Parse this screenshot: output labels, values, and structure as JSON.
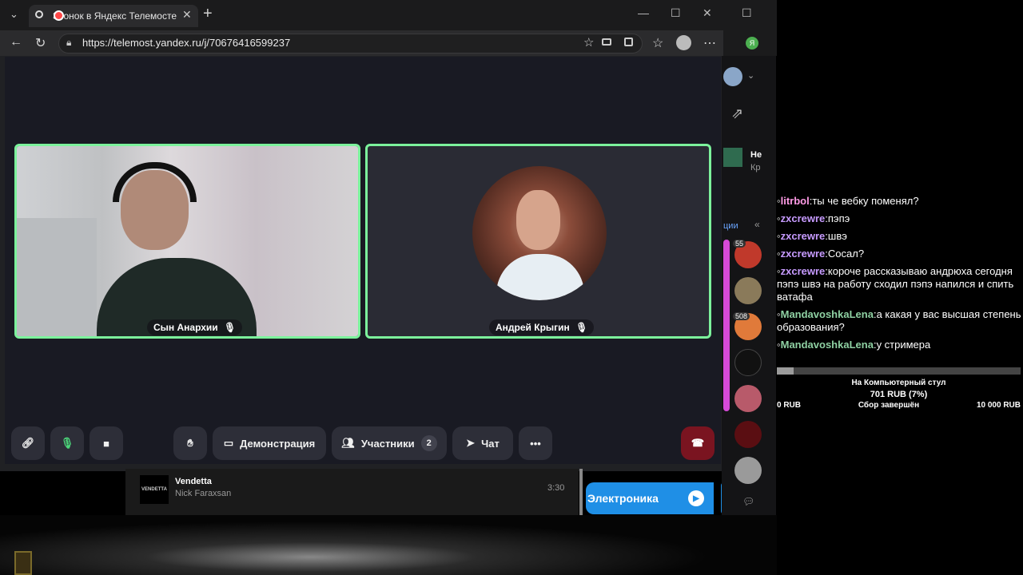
{
  "browser": {
    "tab_title": "Звонок в Яндекс Телемосте",
    "url": "https://telemost.yandex.ru/j/70676416599237",
    "ext_letter": "Я"
  },
  "call": {
    "participants": [
      {
        "name": "Сын Анархии"
      },
      {
        "name": "Андрей Крыгин"
      }
    ],
    "controls": {
      "demo_label": "Демонстрация",
      "participants_label": "Участники",
      "participants_count": "2",
      "chat_label": "Чат",
      "more_label": "•••"
    }
  },
  "music": {
    "track_title": "Vendetta",
    "track_artist": "Nick Faraxsan",
    "duration": "3:30",
    "cover_text": "VENDETTA",
    "promo_label": "Электроника"
  },
  "side": {
    "item_title": "Не",
    "item_sub": "Кр",
    "section_label": "ции",
    "badge_55": "55",
    "badge_508": "508"
  },
  "chat": [
    {
      "nick": "litrbol",
      "text": "ты че вебку поменял?",
      "color": "#ff9be6"
    },
    {
      "nick": "zxcrewre",
      "text": "пэпэ",
      "color": "#c79bff"
    },
    {
      "nick": "zxcrewre",
      "text": "швэ",
      "color": "#c79bff"
    },
    {
      "nick": "zxcrewre",
      "text": "Сосал?",
      "color": "#c79bff"
    },
    {
      "nick": "zxcrewre",
      "text": "короче рассказываю андрюха сегодня пэпэ швэ на работу сходил пэпэ напился и спить ватафа",
      "color": "#c79bff"
    },
    {
      "nick": "MandavoshkaLena",
      "text": "а какая у вас высшая степень образования?",
      "color": "#8fd1a3"
    },
    {
      "nick": "MandavoshkaLena",
      "text": "у стримера",
      "color": "#8fd1a3"
    }
  ],
  "donation": {
    "title": "На Компьютерный стул",
    "raised": "701 RUB (7%)",
    "progress": 0.07,
    "min": "0 RUB",
    "status": "Сбор завершён",
    "max": "10 000 RUB"
  }
}
